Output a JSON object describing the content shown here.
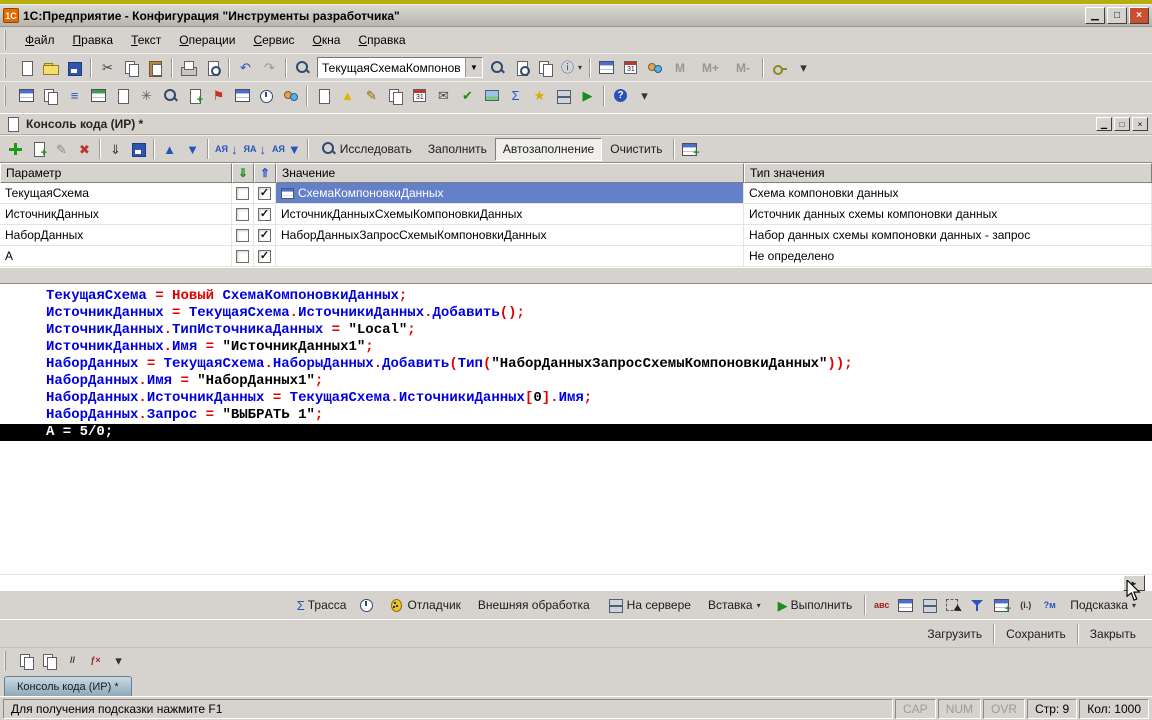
{
  "window": {
    "title": "1С:Предприятие - Конфигурация \"Инструменты разработчика\"",
    "app_badge": "1С",
    "controls": [
      {
        "name": "minimize-button",
        "glyph": "▁"
      },
      {
        "name": "restore-button",
        "glyph": "□"
      },
      {
        "name": "close-button",
        "glyph": "×",
        "close": true
      }
    ]
  },
  "menu": {
    "items": [
      "Файл",
      "Правка",
      "Текст",
      "Операции",
      "Сервис",
      "Окна",
      "Справка"
    ]
  },
  "toolbar_main": {
    "items_left": [
      {
        "name": "new-document-icon",
        "shape": "sheet"
      },
      {
        "name": "open-icon",
        "shape": "folder"
      },
      {
        "name": "save-icon",
        "shape": "floppy"
      },
      {
        "sep": true
      },
      {
        "name": "cut-icon",
        "glyph": "✂",
        "color": "#3a3a3a"
      },
      {
        "name": "copy-icon",
        "shape": "copy"
      },
      {
        "name": "paste-icon",
        "shape": "paste"
      },
      {
        "sep": true
      },
      {
        "name": "print-icon",
        "shape": "printer"
      },
      {
        "name": "print-preview-icon",
        "shape": "preview"
      },
      {
        "sep": true
      },
      {
        "name": "undo-icon",
        "glyph": "↶",
        "color": "#2a52be"
      },
      {
        "name": "redo-icon",
        "glyph": "↷",
        "color": "#9a968f"
      },
      {
        "sep": true
      },
      {
        "name": "find-icon",
        "shape": "magnifier"
      }
    ],
    "combo": {
      "value": "ТекущаяСхемаКомпонов"
    },
    "items_right": [
      {
        "name": "find-next-icon",
        "shape": "magnifier"
      },
      {
        "name": "find-in-data-icon",
        "shape": "preview"
      },
      {
        "name": "copy-value-icon",
        "shape": "copy"
      },
      {
        "name": "info-icon",
        "glyph": "ⓘ",
        "color": "#2a52be",
        "dropdown": true
      },
      {
        "sep": true
      },
      {
        "name": "table-icon",
        "shape": "grid"
      },
      {
        "name": "calendar-icon",
        "shape": "calendar"
      },
      {
        "name": "users-icon",
        "shape": "users"
      },
      {
        "name": "memory-button",
        "label": "M",
        "muted": true
      },
      {
        "name": "memory-plus-button",
        "label": "M+",
        "muted": true
      },
      {
        "name": "memory-minus-button",
        "label": "M-",
        "muted": true
      },
      {
        "sep": true
      },
      {
        "name": "service-key-icon",
        "shape": "key"
      },
      {
        "name": "toolbar-overflow-icon",
        "glyph": "▾",
        "color": "#333"
      }
    ]
  },
  "toolbar_dev": {
    "items": [
      {
        "name": "interface-panel-icon",
        "shape": "grid"
      },
      {
        "name": "windows-icon",
        "shape": "copy"
      },
      {
        "name": "metadata-tree-icon",
        "glyph": "≡",
        "color": "#2a52be"
      },
      {
        "name": "table-tool-icon",
        "shape": "grid2"
      },
      {
        "name": "form-icon",
        "shape": "sheet"
      },
      {
        "name": "settings-icon",
        "glyph": "✳",
        "color": "#5a5a66"
      },
      {
        "name": "search-metadata-icon",
        "shape": "magnifier"
      },
      {
        "name": "module-icon",
        "shape": "sheet-plus"
      },
      {
        "name": "bookmark-flag-icon",
        "glyph": "⚑",
        "color": "#c23328"
      },
      {
        "name": "query-console-icon",
        "shape": "grid"
      },
      {
        "name": "jobs-clock-icon",
        "shape": "clock"
      },
      {
        "name": "sessions-icon",
        "shape": "users"
      },
      {
        "sep": true
      },
      {
        "name": "document-icon",
        "shape": "sheet"
      },
      {
        "name": "warning-icon",
        "glyph": "▲",
        "color": "#e2b500"
      },
      {
        "name": "edit-code-icon",
        "glyph": "✎",
        "color": "#946300"
      },
      {
        "name": "compare-icon",
        "shape": "copy"
      },
      {
        "name": "log-book-icon",
        "shape": "calendar"
      },
      {
        "name": "mail-icon",
        "glyph": "✉",
        "color": "#4a4a52"
      },
      {
        "name": "check-config-icon",
        "glyph": "✔",
        "color": "#1a8c1a"
      },
      {
        "name": "image-icon",
        "shape": "img"
      },
      {
        "name": "sum-icon",
        "glyph": "Σ",
        "color": "#2a52be"
      },
      {
        "name": "star-icon",
        "glyph": "★",
        "color": "#e2a800"
      },
      {
        "name": "db-icon",
        "shape": "server"
      },
      {
        "name": "run-tool-icon",
        "glyph": "▶",
        "color": "#1a8c1a"
      },
      {
        "sep": true
      },
      {
        "name": "help-icon",
        "shape": "help"
      },
      {
        "name": "dev-overflow-icon",
        "glyph": "▾",
        "color": "#333"
      }
    ]
  },
  "panel": {
    "title": "Консоль кода (ИР) *",
    "controls": [
      {
        "name": "panel-minimize-button",
        "glyph": "▁"
      },
      {
        "name": "panel-restore-button",
        "glyph": "□"
      },
      {
        "name": "panel-close-button",
        "glyph": "×"
      }
    ],
    "toolbar": [
      {
        "name": "add-icon",
        "shape": "plus"
      },
      {
        "name": "add-copy-icon",
        "shape": "sheet-plus"
      },
      {
        "name": "edit-icon",
        "glyph": "✎",
        "color": "#8a8a84"
      },
      {
        "name": "delete-icon",
        "glyph": "✖",
        "color": "#c23328"
      },
      {
        "sep": true
      },
      {
        "name": "import-icon",
        "glyph": "⇓",
        "color": "#333"
      },
      {
        "name": "save-list-icon",
        "shape": "floppy"
      },
      {
        "sep": true
      },
      {
        "name": "move-up-icon",
        "glyph": "▲",
        "color": "#2a52be"
      },
      {
        "name": "move-down-icon",
        "glyph": "▼",
        "color": "#2a52be"
      },
      {
        "sep": true
      },
      {
        "name": "sort-ascending-icon",
        "text": "АЯ",
        "glyph": "↓",
        "color": "#2a52be"
      },
      {
        "name": "sort-descending-icon",
        "text": "ЯА",
        "glyph": "↓",
        "color": "#2a52be"
      },
      {
        "name": "filter-sort-icon",
        "text": "АЯ",
        "glyph": "▼",
        "color": "#2a52be"
      },
      {
        "sep": true
      },
      {
        "name": "investigate-button",
        "shape": "magnifier",
        "label": "Исследовать"
      },
      {
        "name": "fill-button",
        "label": "Заполнить"
      },
      {
        "name": "autofill-button",
        "label": "Автозаполнение",
        "pressed": true
      },
      {
        "name": "clear-button",
        "label": "Очистить"
      },
      {
        "sep": true
      },
      {
        "name": "table-settings-icon",
        "shape": "grid-plus"
      }
    ]
  },
  "table": {
    "columns": [
      {
        "label": "Параметр"
      },
      {
        "icon": "fill-export-icon",
        "glyph": "⇓",
        "color": "#1a8c1a"
      },
      {
        "icon": "fill-import-icon",
        "glyph": "⇑",
        "color": "#2a52be"
      },
      {
        "label": "Значение"
      },
      {
        "label": "Тип значения"
      }
    ],
    "rows": [
      {
        "param": "ТекущаяСхема",
        "cb1": false,
        "cb2": true,
        "value": "СхемаКомпоновкиДанных",
        "value_icon": true,
        "selected": true,
        "type": "Схема компоновки данных"
      },
      {
        "param": "ИсточникДанных",
        "cb1": false,
        "cb2": true,
        "value": "ИсточникДанныхСхемыКомпоновкиДанных",
        "value_icon": false,
        "selected": false,
        "type": "Источник данных схемы компоновки данных"
      },
      {
        "param": "НаборДанных",
        "cb1": false,
        "cb2": true,
        "value": "НаборДанныхЗапросСхемыКомпоновкиДанных",
        "value_icon": false,
        "selected": false,
        "type": "Набор данных схемы компоновки данных - запрос"
      },
      {
        "param": "А",
        "cb1": false,
        "cb2": true,
        "value": "",
        "value_icon": false,
        "selected": false,
        "type": "Не определено"
      }
    ]
  },
  "code": {
    "lines": [
      {
        "hl": false,
        "t": [
          [
            "id",
            "ТекущаяСхема"
          ],
          [
            "op",
            " = "
          ],
          [
            "kw",
            "Новый"
          ],
          [
            "str",
            " "
          ],
          [
            "id",
            "СхемаКомпоновкиДанных"
          ],
          [
            "op",
            ";"
          ]
        ]
      },
      {
        "hl": false,
        "t": [
          [
            "id",
            "ИсточникДанных"
          ],
          [
            "op",
            " = "
          ],
          [
            "id",
            "ТекущаяСхема"
          ],
          [
            "op",
            "."
          ],
          [
            "id",
            "ИсточникиДанных"
          ],
          [
            "op",
            "."
          ],
          [
            "id",
            "Добавить"
          ],
          [
            "op",
            "();"
          ]
        ]
      },
      {
        "hl": false,
        "t": [
          [
            "id",
            "ИсточникДанных"
          ],
          [
            "op",
            "."
          ],
          [
            "id",
            "ТипИсточникаДанных"
          ],
          [
            "op",
            " = "
          ],
          [
            "str",
            "\"Local\""
          ],
          [
            "op",
            ";"
          ]
        ]
      },
      {
        "hl": false,
        "t": [
          [
            "id",
            "ИсточникДанных"
          ],
          [
            "op",
            "."
          ],
          [
            "id",
            "Имя"
          ],
          [
            "op",
            " = "
          ],
          [
            "str",
            "\"ИсточникДанных1\""
          ],
          [
            "op",
            ";"
          ]
        ]
      },
      {
        "hl": false,
        "t": [
          [
            "id",
            "НаборДанных"
          ],
          [
            "op",
            " = "
          ],
          [
            "id",
            "ТекущаяСхема"
          ],
          [
            "op",
            "."
          ],
          [
            "id",
            "НаборыДанных"
          ],
          [
            "op",
            "."
          ],
          [
            "id",
            "Добавить"
          ],
          [
            "op",
            "("
          ],
          [
            "id",
            "Тип"
          ],
          [
            "op",
            "("
          ],
          [
            "str",
            "\"НаборДанныхЗапросСхемыКомпоновкиДанных\""
          ],
          [
            "op",
            "));"
          ]
        ]
      },
      {
        "hl": false,
        "t": [
          [
            "id",
            "НаборДанных"
          ],
          [
            "op",
            "."
          ],
          [
            "id",
            "Имя"
          ],
          [
            "op",
            " = "
          ],
          [
            "str",
            "\"НаборДанных1\""
          ],
          [
            "op",
            ";"
          ]
        ]
      },
      {
        "hl": false,
        "t": [
          [
            "id",
            "НаборДанных"
          ],
          [
            "op",
            "."
          ],
          [
            "id",
            "ИсточникДанных"
          ],
          [
            "op",
            " = "
          ],
          [
            "id",
            "ТекущаяСхема"
          ],
          [
            "op",
            "."
          ],
          [
            "id",
            "ИсточникиДанных"
          ],
          [
            "op",
            "["
          ],
          [
            "num",
            "0"
          ],
          [
            "op",
            "]."
          ],
          [
            "id",
            "Имя"
          ],
          [
            "op",
            ";"
          ]
        ]
      },
      {
        "hl": false,
        "t": [
          [
            "id",
            "НаборДанных"
          ],
          [
            "op",
            "."
          ],
          [
            "id",
            "Запрос"
          ],
          [
            "op",
            " = "
          ],
          [
            "str",
            "\"ВЫБРАТЬ 1\""
          ],
          [
            "op",
            ";"
          ]
        ]
      },
      {
        "hl": true,
        "t": [
          [
            "hl",
            "А = 5/0;"
          ]
        ]
      }
    ]
  },
  "scroll": {
    "right_glyph": "►"
  },
  "cmdbar": {
    "items": [
      {
        "name": "trace-button",
        "glyph": "Σ",
        "color": "#2a52be",
        "label": "Трасса"
      },
      {
        "name": "timing-icon-button",
        "shape": "clock"
      },
      {
        "name": "debugger-button",
        "shape": "bug",
        "label": "Отладчик"
      },
      {
        "name": "external-processing-button",
        "label": "Внешняя обработка"
      },
      {
        "name": "on-server-button",
        "shape": "server",
        "label": "На сервере"
      },
      {
        "name": "insert-button",
        "label": "Вставка",
        "dropdown": true
      },
      {
        "name": "run-button",
        "glyph": "▶",
        "color": "#1a8c1a",
        "label": "Выполнить"
      },
      {
        "sep": true
      },
      {
        "name": "spellcheck-icon",
        "text": "авс",
        "color": "#a02020"
      },
      {
        "name": "grid-edit-icon",
        "shape": "grid"
      },
      {
        "name": "db-save-icon",
        "shape": "server"
      },
      {
        "name": "select-area-icon",
        "shape": "select"
      },
      {
        "name": "filter-icon",
        "shape": "funnel"
      },
      {
        "name": "format-grid-icon",
        "shape": "grid-plus"
      },
      {
        "name": "info-small-icon",
        "text": "(i.)",
        "color": "#333"
      },
      {
        "name": "context-help-icon",
        "text": "?м",
        "color": "#2a52be"
      },
      {
        "name": "hint-button",
        "label": "Подсказка",
        "dropdown": true
      }
    ]
  },
  "actions": {
    "items": [
      {
        "name": "load-button",
        "label": "Загрузить"
      },
      {
        "sep": true
      },
      {
        "name": "save-form-button",
        "label": "Сохранить"
      },
      {
        "sep": true
      },
      {
        "name": "close-form-button",
        "label": "Закрыть"
      }
    ]
  },
  "minibar": {
    "items": [
      {
        "name": "copy-block-icon",
        "shape": "copy"
      },
      {
        "name": "copy-block-alt-icon",
        "shape": "copy"
      },
      {
        "name": "comment-icon",
        "text": "//",
        "color": "#333"
      },
      {
        "name": "syntax-check-icon",
        "text": "ƒ×",
        "color": "#a02020"
      },
      {
        "name": "minibar-overflow-icon",
        "glyph": "▾",
        "color": "#333"
      }
    ]
  },
  "tab": {
    "label": "Консоль кода (ИР) *"
  },
  "status": {
    "hint": "Для получения подсказки нажмите F1",
    "panels": [
      {
        "label": "CAP",
        "muted": true
      },
      {
        "label": "NUM",
        "muted": true
      },
      {
        "label": "OVR",
        "muted": true
      },
      {
        "label": "Стр: 9",
        "muted": false
      },
      {
        "label": "Кол: 1000",
        "muted": false
      }
    ]
  }
}
